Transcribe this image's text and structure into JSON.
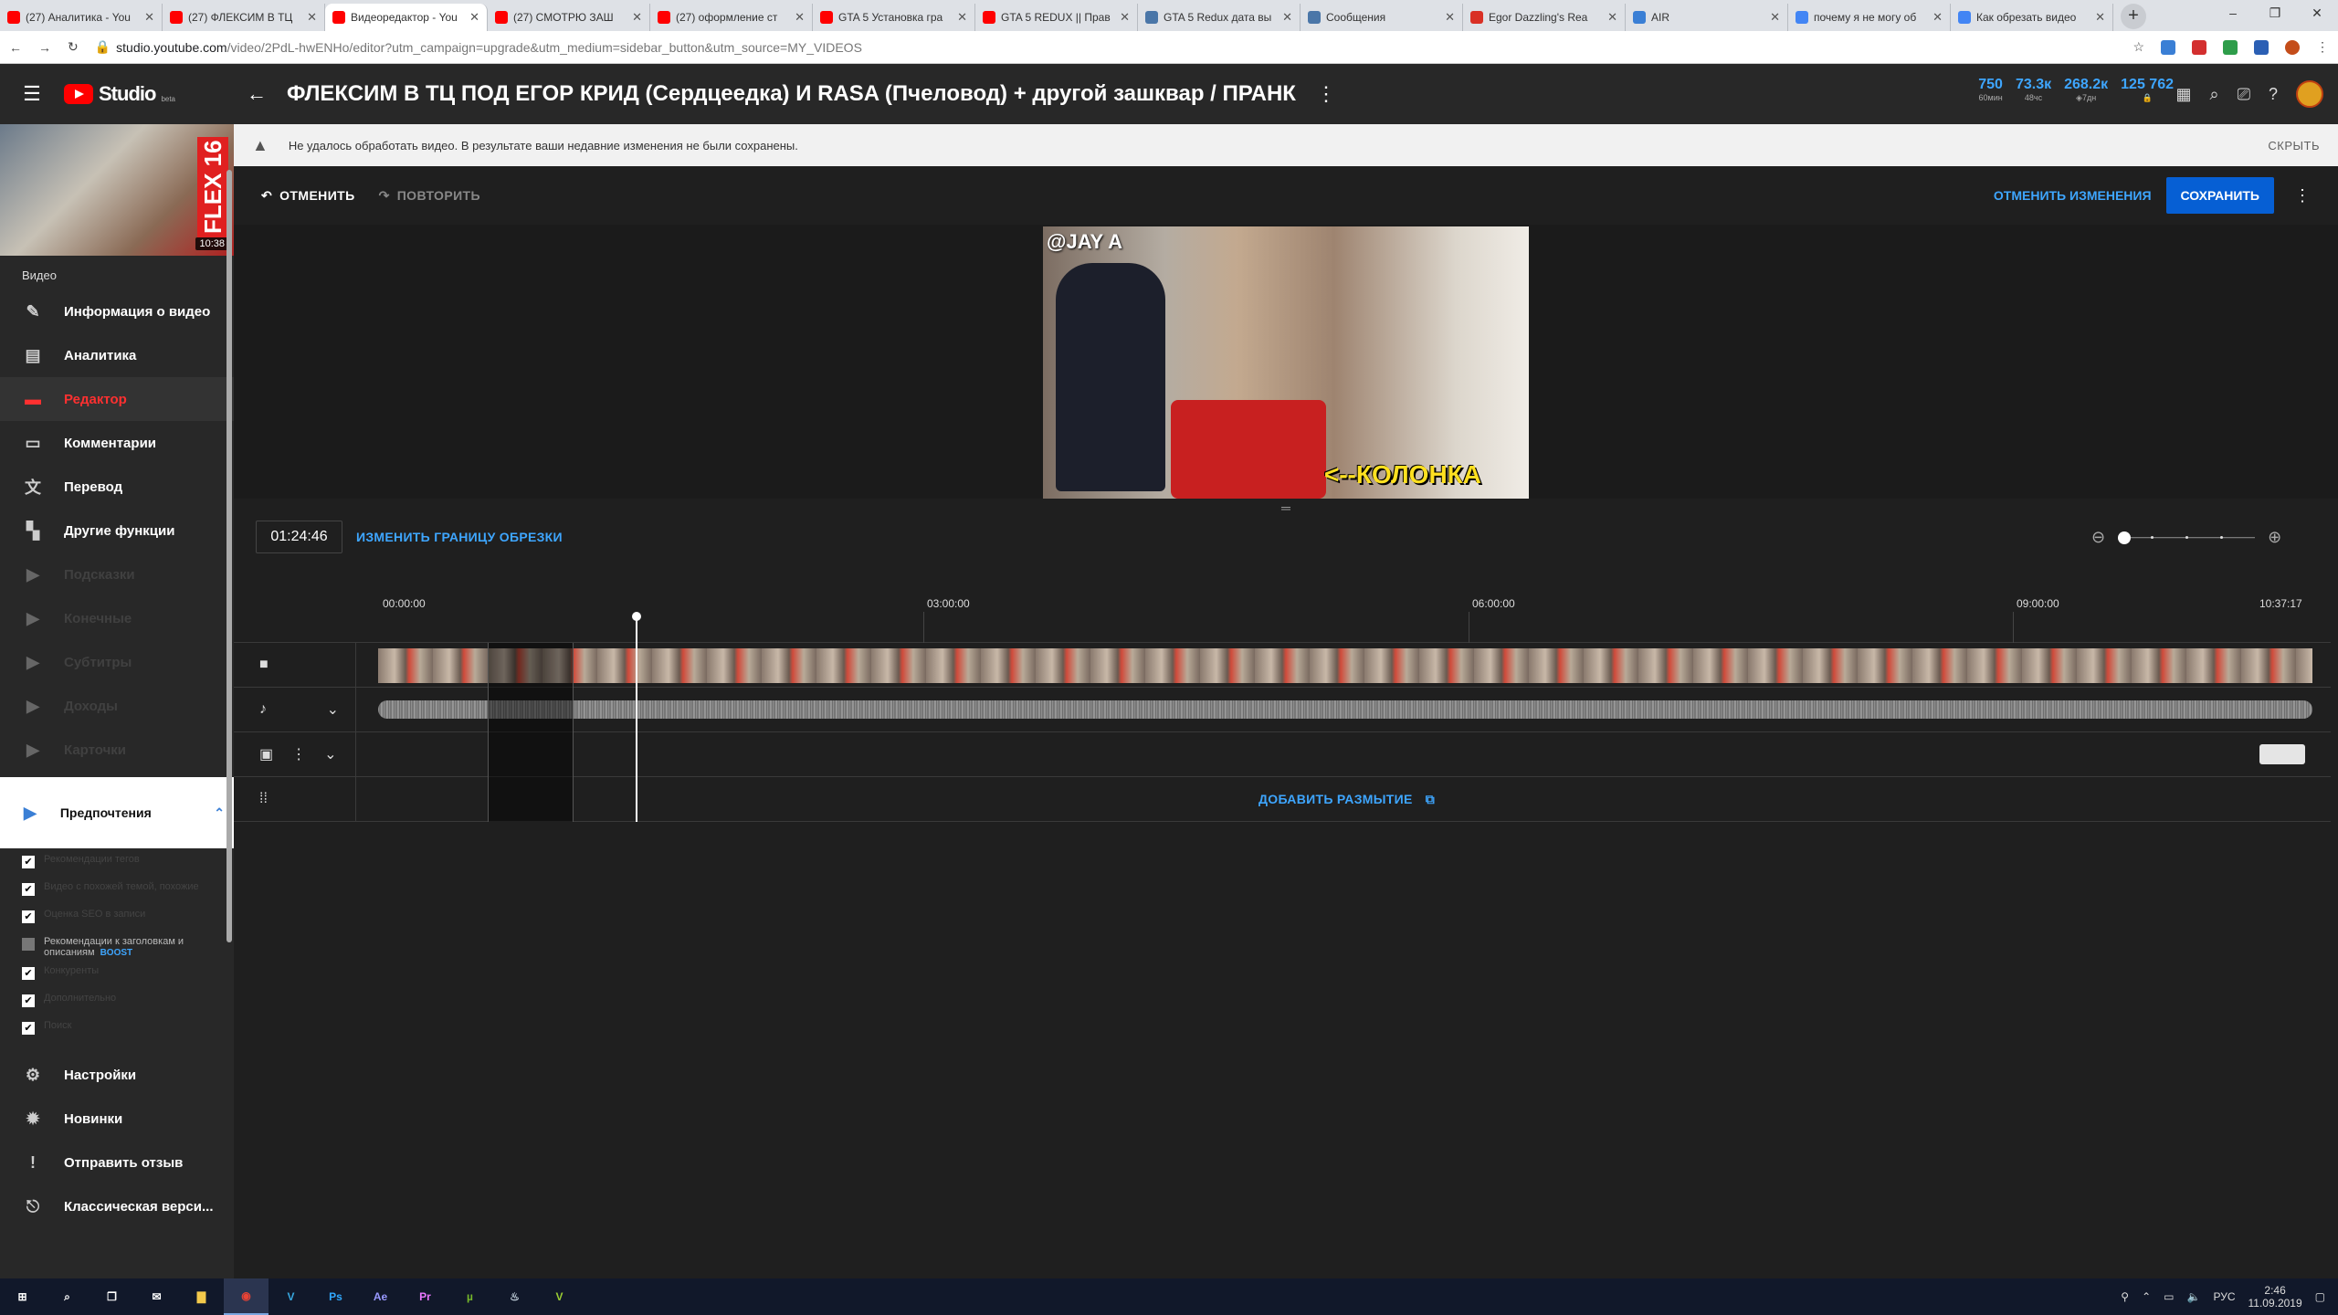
{
  "browser": {
    "tabs": [
      {
        "title": "(27) Аналитика - You",
        "icon": "youtube-icon",
        "color": "#ff0000"
      },
      {
        "title": "(27) ФЛЕКСИМ В ТЦ",
        "icon": "youtube-icon",
        "color": "#ff0000"
      },
      {
        "title": "Видеоредактор - You",
        "icon": "youtube-icon",
        "color": "#ff0000",
        "active": true
      },
      {
        "title": "(27) СМОТРЮ ЗАШ",
        "icon": "youtube-icon",
        "color": "#ff0000"
      },
      {
        "title": "(27) оформление ст",
        "icon": "youtube-icon",
        "color": "#ff0000"
      },
      {
        "title": "GTA 5 Установка гра",
        "icon": "youtube-icon",
        "color": "#ff0000"
      },
      {
        "title": "GTA 5 REDUX || Прав",
        "icon": "youtube-icon",
        "color": "#ff0000"
      },
      {
        "title": "GTA 5 Redux дата вы",
        "icon": "site-icon",
        "color": "#4a76a8"
      },
      {
        "title": "Сообщения",
        "icon": "vk-icon",
        "color": "#4a76a8"
      },
      {
        "title": "Egor Dazzling's Rea",
        "icon": "chart-icon",
        "color": "#d93025"
      },
      {
        "title": "AIR",
        "icon": "air-icon",
        "color": "#3a7fd5"
      },
      {
        "title": "почему я не могу об",
        "icon": "google-icon",
        "color": "#4285f4"
      },
      {
        "title": "Как обрезать видео",
        "icon": "google-icon",
        "color": "#4285f4"
      }
    ],
    "url_main": "studio.youtube.com",
    "url_path": "/video/2PdL-hwENHo/editor?utm_campaign=upgrade&utm_medium=sidebar_button&utm_source=MY_VIDEOS"
  },
  "header": {
    "title": "ФЛЕКСИМ В ТЦ ПОД ЕГОР КРИД (Сердцеедка) И RASA (Пчеловод) + другой зашквар / ПРАНК",
    "logo_text": "Studio",
    "logo_beta": "beta",
    "stats": [
      {
        "value": "750",
        "label": "60мин"
      },
      {
        "value": "73.3к",
        "label": "48чс"
      },
      {
        "value": "268.2к",
        "label": "◈7дн"
      },
      {
        "value": "125 762",
        "label": "🔒"
      }
    ]
  },
  "banner": {
    "message": "Не удалось обработать видео. В результате ваши недавние изменения не были сохранены.",
    "hide_label": "СКРЫТЬ"
  },
  "sidebar": {
    "thumb_overlay": "FLEX 16",
    "duration": "10:38",
    "section_label": "Видео",
    "items": [
      {
        "label": "Информация о видео",
        "icon": "pencil-icon",
        "glyph": "✎"
      },
      {
        "label": "Аналитика",
        "icon": "analytics-icon",
        "glyph": "▤"
      },
      {
        "label": "Редактор",
        "icon": "editor-icon",
        "glyph": "▬",
        "active": true
      },
      {
        "label": "Комментарии",
        "icon": "comments-icon",
        "glyph": "▭"
      },
      {
        "label": "Перевод",
        "icon": "translate-icon",
        "glyph": "文"
      },
      {
        "label": "Другие функции",
        "icon": "other-features-icon",
        "glyph": "▚"
      },
      {
        "label": "Подсказки",
        "icon": "play-icon",
        "glyph": "▶",
        "dim": true
      },
      {
        "label": "Конечные",
        "icon": "play-icon",
        "glyph": "▶",
        "dim": true
      },
      {
        "label": "Субтитры",
        "icon": "play-icon",
        "glyph": "▶",
        "dim": true
      },
      {
        "label": "Доходы",
        "icon": "play-icon",
        "glyph": "▶",
        "dim": true
      },
      {
        "label": "Карточки",
        "icon": "play-icon",
        "glyph": "▶",
        "dim": true
      }
    ],
    "prefs_label": "Предпочтения",
    "checkboxes": [
      {
        "label": "Рекомендации тегов",
        "checked": true
      },
      {
        "label": "Видео с похожей темой, похожие",
        "checked": true
      },
      {
        "label": "Оценка SEO в записи",
        "checked": true
      },
      {
        "label": "Рекомендации к заголовкам и описаниям",
        "checked": false,
        "lit": true,
        "badge": "BOOST"
      },
      {
        "label": "Конкуренты",
        "checked": true
      },
      {
        "label": "Дополнительно",
        "checked": true
      },
      {
        "label": "Поиск",
        "checked": true
      }
    ],
    "bottom_items": [
      {
        "label": "Настройки",
        "icon": "settings-icon",
        "glyph": "⚙"
      },
      {
        "label": "Новинки",
        "icon": "whats-new-icon",
        "glyph": "✹"
      },
      {
        "label": "Отправить отзыв",
        "icon": "feedback-icon",
        "glyph": "!"
      },
      {
        "label": "Классическая верси...",
        "icon": "classic-icon",
        "glyph": "⎋"
      }
    ]
  },
  "editor": {
    "undo_label": "ОТМЕНИТЬ",
    "redo_label": "ПОВТОРИТЬ",
    "discard_label": "ОТМЕНИТЬ ИЗМЕНЕНИЯ",
    "save_label": "СОХРАНИТЬ",
    "video_overlay_handle": "@JAY A",
    "video_overlay_caption": "<--КОЛОНКА",
    "current_time": "01:24:46",
    "trim_link": "ИЗМЕНИТЬ ГРАНИЦУ ОБРЕЗКИ",
    "zoom_level": 0,
    "ruler": [
      {
        "label": "00:00:00"
      },
      {
        "label": "03:00:00"
      },
      {
        "label": "06:00:00"
      },
      {
        "label": "09:00:00"
      },
      {
        "label": "10:37:17"
      }
    ],
    "add_blur_label": "ДОБАВИТЬ РАЗМЫТИЕ"
  },
  "taskbar": {
    "apps": [
      {
        "name": "windows-start-icon",
        "glyph": "⊞",
        "color": "#ffffff"
      },
      {
        "name": "search-icon",
        "glyph": "⌕",
        "color": "#ffffff"
      },
      {
        "name": "task-view-icon",
        "glyph": "❐",
        "color": "#ffffff"
      },
      {
        "name": "mail-icon",
        "glyph": "✉",
        "color": "#ffffff"
      },
      {
        "name": "explorer-icon",
        "glyph": "▇",
        "color": "#f3c94b"
      },
      {
        "name": "chrome-icon",
        "glyph": "◉",
        "color": "#ea4335",
        "active": true
      },
      {
        "name": "vegas-icon",
        "glyph": "V",
        "color": "#38a8e0"
      },
      {
        "name": "photoshop-icon",
        "glyph": "Ps",
        "color": "#31a8ff"
      },
      {
        "name": "after-effects-icon",
        "glyph": "Ae",
        "color": "#9999ff"
      },
      {
        "name": "premiere-icon",
        "glyph": "Pr",
        "color": "#ea77ff"
      },
      {
        "name": "utorrent-icon",
        "glyph": "µ",
        "color": "#76b82a"
      },
      {
        "name": "steam-icon",
        "glyph": "♨",
        "color": "#c7d5e0"
      },
      {
        "name": "gta-icon",
        "glyph": "V",
        "color": "#9acd32"
      }
    ],
    "lang": "РУС",
    "time": "2:46",
    "date": "11.09.2019"
  }
}
